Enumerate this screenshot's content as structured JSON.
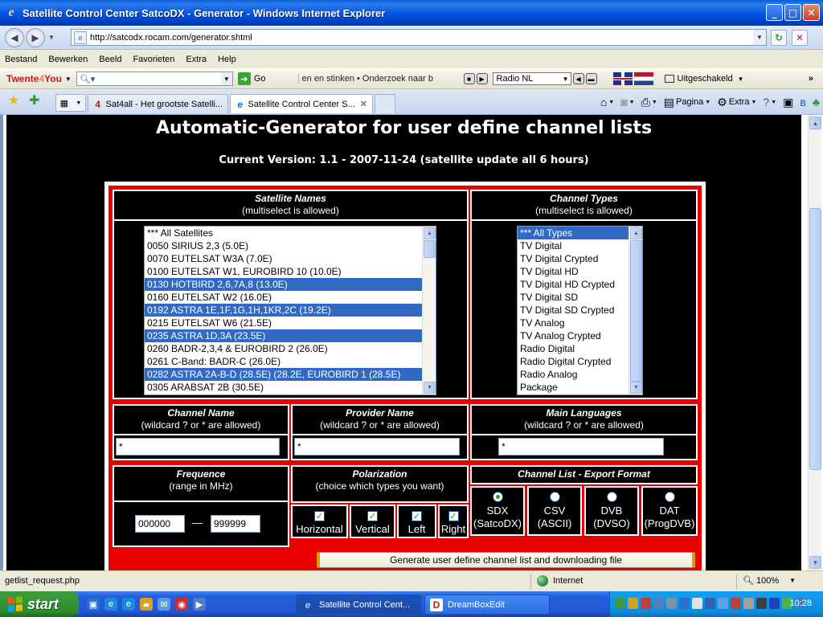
{
  "window": {
    "title": "Satellite Control Center SatcoDX - Generator - Windows Internet Explorer",
    "minimize": "_",
    "maximize": "□",
    "close": "✕"
  },
  "address": {
    "url": "http://satcodx.rocam.com/generator.shtml"
  },
  "menu": [
    "Bestand",
    "Bewerken",
    "Beeld",
    "Favorieten",
    "Extra",
    "Help"
  ],
  "toolbar": {
    "brand_a": "Twente",
    "brand_b": "4",
    "brand_c": "You",
    "go_label": "Go",
    "ticker": "en en stinken • Onderzoek naar b",
    "radio_station": "Radio NL",
    "popup_status": "Uitgeschakeld"
  },
  "tabs": [
    {
      "label": "Sat4all - Het grootste Satelli...",
      "icon": "4"
    },
    {
      "label": "Satellite Control Center S...",
      "icon": "e"
    }
  ],
  "commands": {
    "page": "Pagina",
    "tools": "Extra"
  },
  "page": {
    "heading": "Automatic-Generator for user define channel lists",
    "version": "Current Version: 1.1 - 2007-11-24 (satellite update all 6 hours)"
  },
  "satellites": {
    "title": "Satellite Names",
    "subtitle": "(multiselect is allowed)",
    "options": [
      {
        "label": "*** All Satellites",
        "selected": false
      },
      {
        "label": "0050 SIRIUS 2,3 (5.0E)",
        "selected": false
      },
      {
        "label": "0070 EUTELSAT W3A (7.0E)",
        "selected": false
      },
      {
        "label": "0100 EUTELSAT W1, EUROBIRD 10 (10.0E)",
        "selected": false
      },
      {
        "label": "0130 HOTBIRD 2,6,7A,8 (13.0E)",
        "selected": true
      },
      {
        "label": "0160 EUTELSAT W2 (16.0E)",
        "selected": false
      },
      {
        "label": "0192 ASTRA 1E,1F,1G,1H,1KR,2C (19.2E)",
        "selected": true
      },
      {
        "label": "0215 EUTELSAT W6 (21.5E)",
        "selected": false
      },
      {
        "label": "0235 ASTRA 1D,3A (23.5E)",
        "selected": true
      },
      {
        "label": "0260 BADR-2,3,4 & EUROBIRD 2 (26.0E)",
        "selected": false
      },
      {
        "label": "0261 C-Band: BADR-C (26.0E)",
        "selected": false
      },
      {
        "label": "0282 ASTRA 2A-B-D (28.5E) (28.2E, EUROBIRD 1 (28.5E)",
        "selected": true
      },
      {
        "label": "0305 ARABSAT 2B (30.5E)",
        "selected": false
      }
    ]
  },
  "channel_types": {
    "title": "Channel Types",
    "subtitle": "(multiselect is allowed)",
    "options": [
      {
        "label": "*** All Types",
        "selected": true
      },
      {
        "label": "TV Digital",
        "selected": false
      },
      {
        "label": "TV Digital Crypted",
        "selected": false
      },
      {
        "label": "TV Digital HD",
        "selected": false
      },
      {
        "label": "TV Digital HD Crypted",
        "selected": false
      },
      {
        "label": "TV Digital SD",
        "selected": false
      },
      {
        "label": "TV Digital SD Crypted",
        "selected": false
      },
      {
        "label": "TV Analog",
        "selected": false
      },
      {
        "label": "TV Analog Crypted",
        "selected": false
      },
      {
        "label": "Radio Digital",
        "selected": false
      },
      {
        "label": "Radio Digital Crypted",
        "selected": false
      },
      {
        "label": "Radio Analog",
        "selected": false
      },
      {
        "label": "Package",
        "selected": false
      }
    ]
  },
  "channel_name": {
    "title": "Channel Name",
    "subtitle": "(wildcard ? or * are allowed)",
    "value": "*"
  },
  "provider_name": {
    "title": "Provider Name",
    "subtitle": "(wildcard ? or * are allowed)",
    "value": "*"
  },
  "main_languages": {
    "title": "Main Languages",
    "subtitle": "(wildcard ? or * are allowed)",
    "value": "*"
  },
  "frequence": {
    "title": "Frequence",
    "subtitle": "(range in MHz)",
    "from": "000000",
    "separator": "—",
    "to": "999999"
  },
  "polarization": {
    "title": "Polarization",
    "subtitle": "(choice which types you want)",
    "options": [
      {
        "label": "Horizontal",
        "checked": true
      },
      {
        "label": "Vertical",
        "checked": true
      },
      {
        "label": "Left",
        "checked": true
      },
      {
        "label": "Right",
        "checked": true
      }
    ]
  },
  "export": {
    "title": "Channel List - Export Format",
    "options": [
      {
        "line1": "SDX",
        "line2": "(SatcoDX)",
        "selected": true
      },
      {
        "line1": "CSV",
        "line2": "(ASCII)",
        "selected": false
      },
      {
        "line1": "DVB",
        "line2": "(DVSO)",
        "selected": false
      },
      {
        "line1": "DAT",
        "line2": "(ProgDVB)",
        "selected": false
      }
    ]
  },
  "generate_button": "Generate user define channel list and downloading file",
  "status": {
    "text": "getlist_request.php",
    "zone": "Internet",
    "zoom": "100%"
  },
  "taskbar": {
    "start": "start",
    "items": [
      {
        "label": "Satellite Control Cent...",
        "icon": "e"
      },
      {
        "label": "DreamBoxEdit",
        "icon": "D"
      }
    ],
    "clock": "10:28"
  },
  "colors": {
    "form_red": "#e80000",
    "page_bg": "#000000",
    "selection": "#316ac5"
  }
}
